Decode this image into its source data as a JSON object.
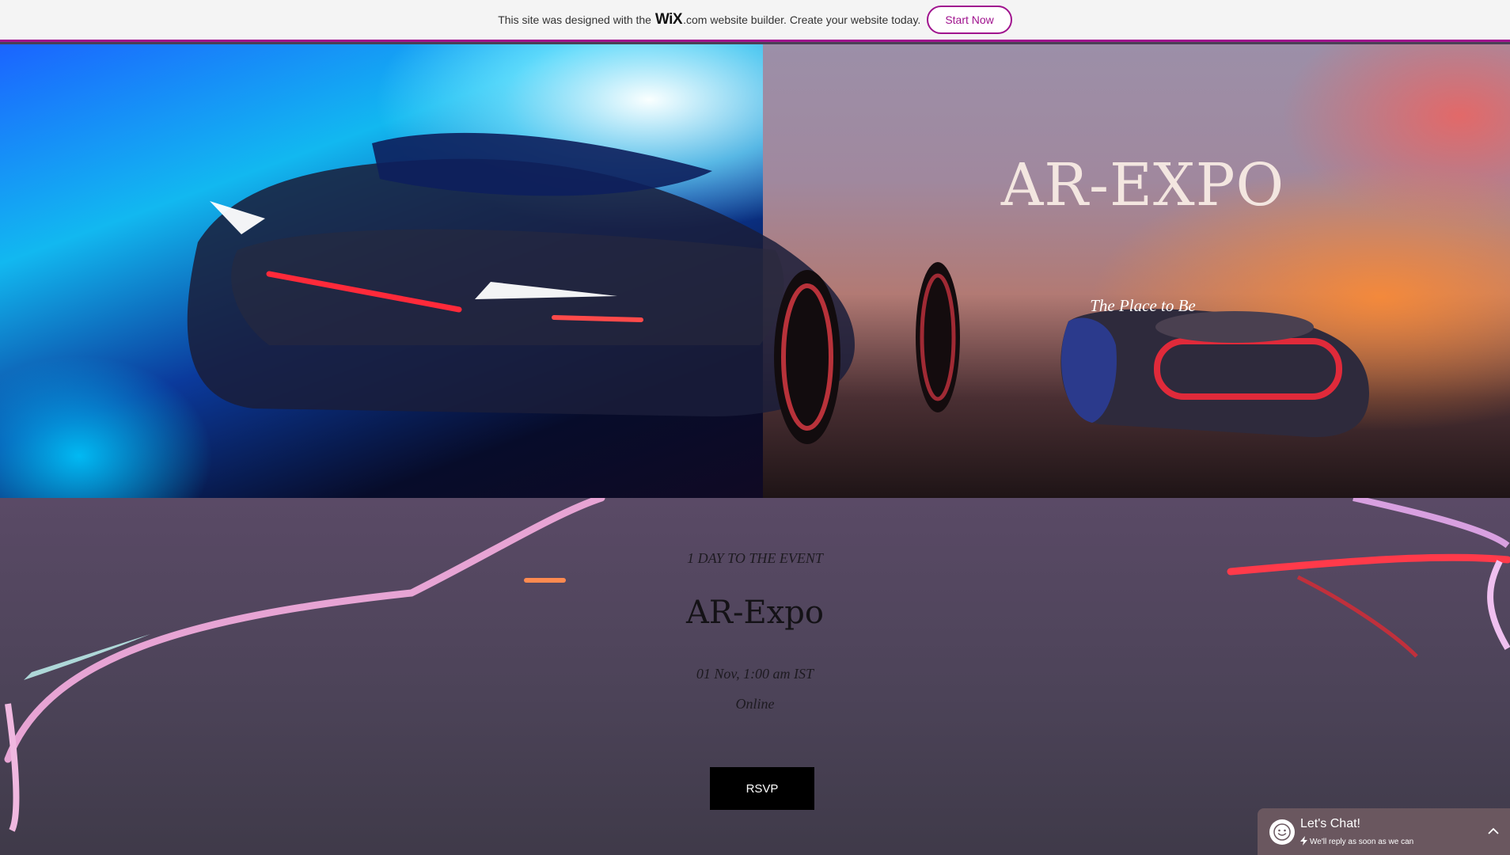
{
  "banner": {
    "text_before": "This site was designed with the",
    "logo": "WiX",
    "dotcom": ".com",
    "text_after": "website builder. Create your website today.",
    "cta_label": "Start Now",
    "accent": "#a0138e"
  },
  "hero": {
    "title": "AR-EXPO",
    "tagline": "The Place to Be"
  },
  "event": {
    "countdown": "1 DAY TO THE EVENT",
    "title": "AR-Expo",
    "date": "01 Nov, 1:00 am IST",
    "location": "Online",
    "rsvp_label": "RSVP"
  },
  "chat": {
    "title": "Let's Chat!",
    "subtitle": "We'll reply as soon as we can",
    "icons": [
      "smile-icon",
      "lightning-icon",
      "chevron-up-icon"
    ]
  }
}
